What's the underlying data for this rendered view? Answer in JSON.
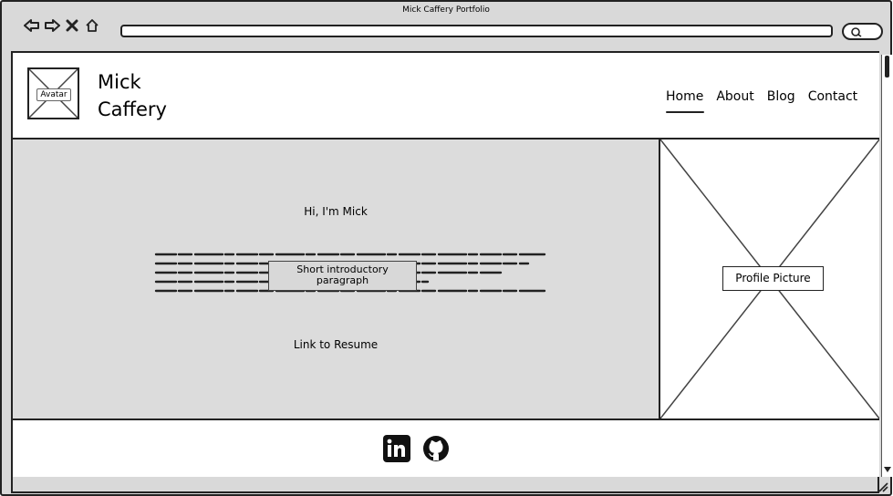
{
  "window": {
    "title": "Mick Caffery Portfolio"
  },
  "browser_icons": [
    "back-arrow-icon",
    "forward-arrow-icon",
    "close-icon",
    "home-icon",
    "search-icon"
  ],
  "header": {
    "avatar_label": "Avatar",
    "name_first": "Mick",
    "name_last": "Caffery",
    "nav": [
      "Home",
      "About",
      "Blog",
      "Contact"
    ],
    "active_nav": "Home"
  },
  "hero": {
    "greeting": "Hi, I'm Mick",
    "intro_line1": "Short introductory",
    "intro_line2": "paragraph",
    "resume_link": "Link to Resume"
  },
  "profile": {
    "label": "Profile Picture"
  },
  "footer": {
    "icons": [
      "linkedin-icon",
      "github-icon"
    ]
  },
  "colors": {
    "hero_bg": "#dcdcdc",
    "chrome_bg": "#d9d9d9",
    "border": "#222222"
  }
}
